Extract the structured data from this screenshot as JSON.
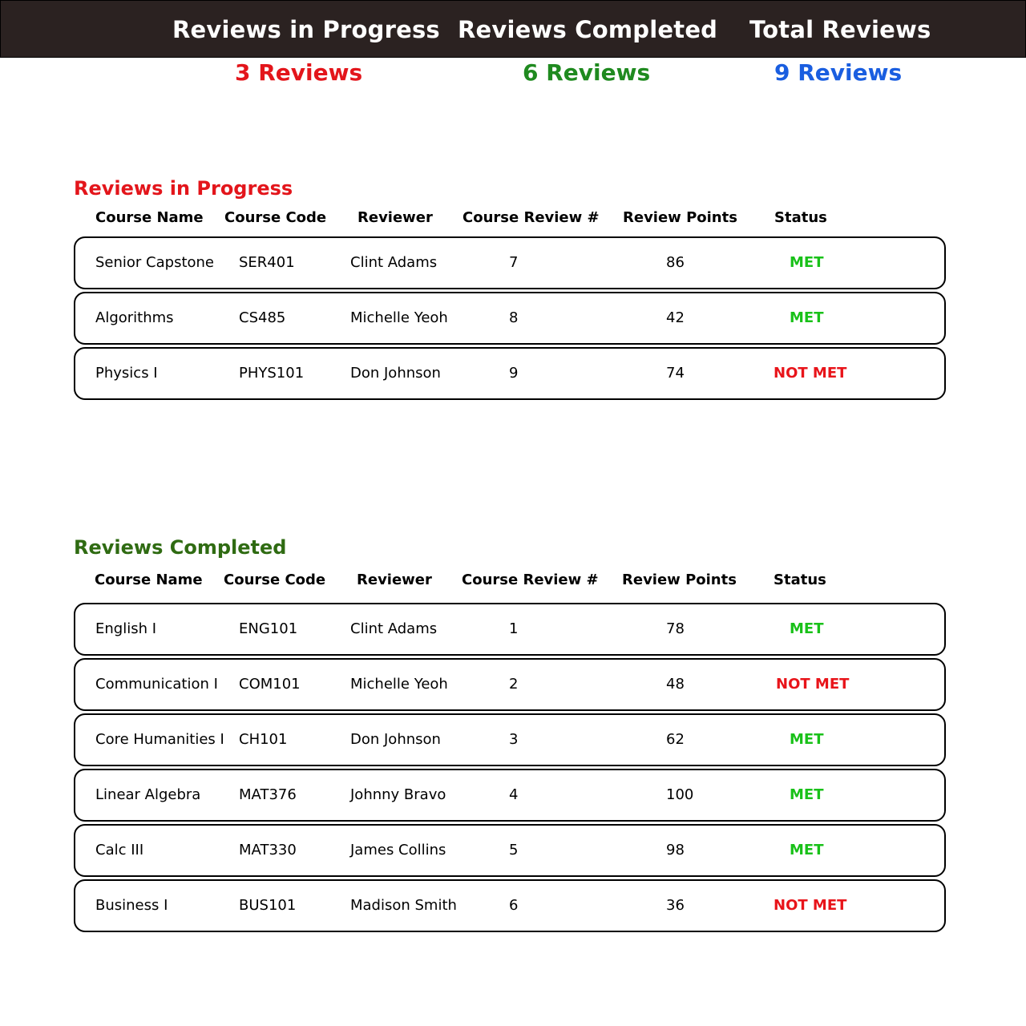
{
  "colors": {
    "in_progress": "#e3151b",
    "completed": "#1f8a1f",
    "total": "#1a5ee0",
    "section_completed": "#2f6b12",
    "met": "#19c119",
    "not_met": "#e8141a"
  },
  "summary": {
    "in_progress": {
      "label": "Reviews in Progress",
      "count": "3 Reviews"
    },
    "completed": {
      "label": "Reviews Completed",
      "count": "6 Reviews"
    },
    "total": {
      "label": "Total Reviews",
      "count": "9 Reviews"
    }
  },
  "columns": [
    "Course Name",
    "Course Code",
    "Reviewer",
    "Course Review #",
    "Review Points",
    "Status"
  ],
  "in_progress": {
    "title": "Reviews in Progress",
    "rows": [
      {
        "course_name": "Senior Capstone",
        "course_code": "SER401",
        "reviewer": "Clint Adams",
        "review_num": "7",
        "points": "86",
        "status": "MET"
      },
      {
        "course_name": "Algorithms",
        "course_code": "CS485",
        "reviewer": "Michelle Yeoh",
        "review_num": "8",
        "points": "42",
        "status": "MET"
      },
      {
        "course_name": "Physics I",
        "course_code": "PHYS101",
        "reviewer": "Don Johnson",
        "review_num": "9",
        "points": "74",
        "status": "NOT MET"
      }
    ]
  },
  "completed": {
    "title": "Reviews Completed",
    "rows": [
      {
        "course_name": "English I",
        "course_code": "ENG101",
        "reviewer": "Clint Adams",
        "review_num": "1",
        "points": "78",
        "status": "MET"
      },
      {
        "course_name": "Communication I",
        "course_code": "COM101",
        "reviewer": "Michelle Yeoh",
        "review_num": "2",
        "points": "48",
        "status": "NOT MET"
      },
      {
        "course_name": "Core Humanities I",
        "course_code": "CH101",
        "reviewer": "Don Johnson",
        "review_num": "3",
        "points": "62",
        "status": "MET"
      },
      {
        "course_name": "Linear Algebra",
        "course_code": "MAT376",
        "reviewer": "Johnny Bravo",
        "review_num": "4",
        "points": "100",
        "status": "MET"
      },
      {
        "course_name": "Calc III",
        "course_code": "MAT330",
        "reviewer": "James Collins",
        "review_num": "5",
        "points": "98",
        "status": "MET"
      },
      {
        "course_name": "Business I",
        "course_code": "BUS101",
        "reviewer": "Madison Smith",
        "review_num": "6",
        "points": "36",
        "status": "NOT MET"
      }
    ]
  }
}
